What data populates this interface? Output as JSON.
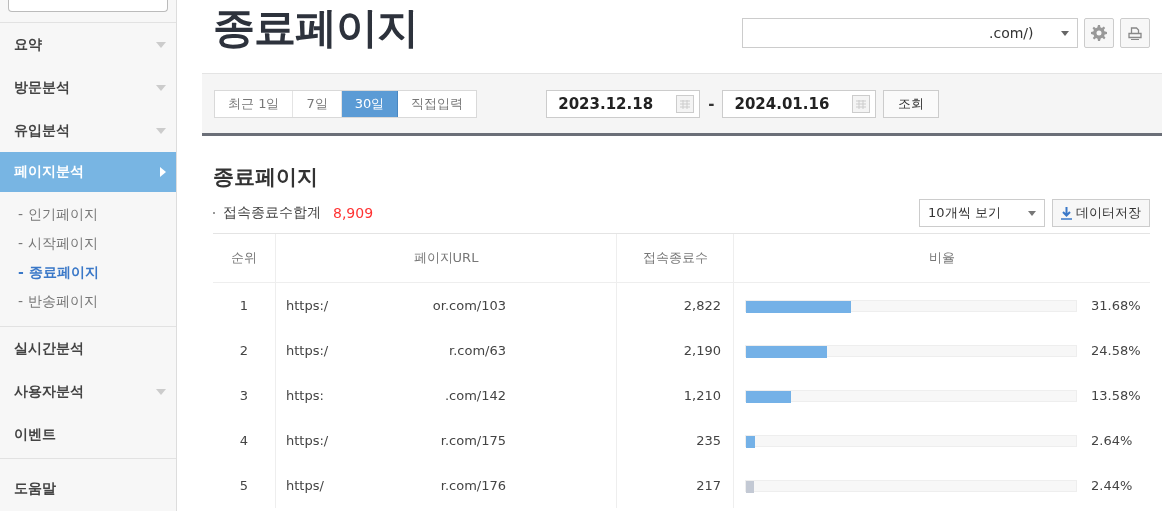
{
  "sidebar": {
    "groups": [
      [
        {
          "label": "요약",
          "has_submenu": true,
          "selected": false
        },
        {
          "label": "방문분석",
          "has_submenu": true,
          "selected": false
        },
        {
          "label": "유입분석",
          "has_submenu": true,
          "selected": false
        },
        {
          "label": "페이지분석",
          "has_submenu": true,
          "selected": true,
          "children": [
            {
              "label": "- 인기페이지",
              "selected": false
            },
            {
              "label": "- 시작페이지",
              "selected": false
            },
            {
              "label": "- 종료페이지",
              "selected": true
            },
            {
              "label": "- 반송페이지",
              "selected": false
            }
          ]
        }
      ],
      [
        {
          "label": "실시간분석",
          "has_submenu": false,
          "selected": false
        },
        {
          "label": "사용자분석",
          "has_submenu": true,
          "selected": false
        },
        {
          "label": "이벤트",
          "has_submenu": false,
          "selected": false
        }
      ],
      [
        {
          "label": "도움말",
          "has_submenu": false,
          "selected": false
        }
      ]
    ]
  },
  "header": {
    "title": "종료페이지",
    "site_select": {
      "value": ".com/)"
    }
  },
  "filter": {
    "periods": [
      {
        "label": "최근 1일",
        "selected": false
      },
      {
        "label": "7일",
        "selected": false
      },
      {
        "label": "30일",
        "selected": true
      },
      {
        "label": "직접입력",
        "selected": false
      }
    ],
    "start_date": "2023.12.18",
    "end_date": "2024.01.16",
    "separator": "-",
    "search_button": "조회"
  },
  "report": {
    "title": "종료페이지",
    "summary_label": "접속종료수합계",
    "summary_value": "8,909",
    "page_size": "10개씩 보기",
    "download_button": "데이터저장",
    "columns": [
      "순위",
      "페이지URL",
      "접속종료수",
      "비율"
    ],
    "rows": [
      {
        "rank": "1",
        "url_start": "https:/",
        "url_end": "or.com/103",
        "count": "2,822",
        "level": 0.3168,
        "ratio": "31.68%",
        "color": "#74b1e7"
      },
      {
        "rank": "2",
        "url_start": "https:/",
        "url_end": "r.com/63",
        "count": "2,190",
        "level": 0.2458,
        "ratio": "24.58%",
        "color": "#74b1e7"
      },
      {
        "rank": "3",
        "url_start": "https:",
        "url_end": ".com/142",
        "count": "1,210",
        "level": 0.1358,
        "ratio": "13.58%",
        "color": "#74b1e7"
      },
      {
        "rank": "4",
        "url_start": "https:/",
        "url_end": "r.com/175",
        "count": "235",
        "level": 0.0264,
        "ratio": "2.64%",
        "color": "#74b1e7"
      },
      {
        "rank": "5",
        "url_start": "https/",
        "url_end": "r.com/176",
        "count": "217",
        "level": 0.0244,
        "ratio": "2.44%",
        "color": "#c3c9d4"
      }
    ]
  }
}
